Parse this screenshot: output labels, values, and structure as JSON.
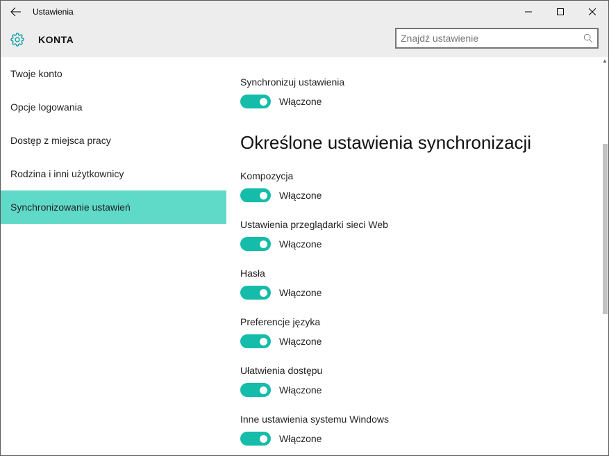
{
  "titlebar": {
    "title": "Ustawienia"
  },
  "header": {
    "title": "KONTA",
    "search_placeholder": "Znajdź ustawienie"
  },
  "sidebar": {
    "items": [
      {
        "label": "Twoje konto"
      },
      {
        "label": "Opcje logowania"
      },
      {
        "label": "Dostęp z miejsca pracy"
      },
      {
        "label": "Rodzina i inni użytkownicy"
      },
      {
        "label": "Synchronizowanie ustawień"
      }
    ]
  },
  "content": {
    "section_heading": "Określone ustawienia synchronizacji",
    "settings": [
      {
        "label": "Synchronizuj ustawienia",
        "state": "Włączone"
      },
      {
        "label": "Kompozycja",
        "state": "Włączone"
      },
      {
        "label": "Ustawienia przeglądarki sieci Web",
        "state": "Włączone"
      },
      {
        "label": "Hasła",
        "state": "Włączone"
      },
      {
        "label": "Preferencje języka",
        "state": "Włączone"
      },
      {
        "label": "Ułatwienia dostępu",
        "state": "Włączone"
      },
      {
        "label": "Inne ustawienia systemu Windows",
        "state": "Włączone"
      }
    ]
  }
}
